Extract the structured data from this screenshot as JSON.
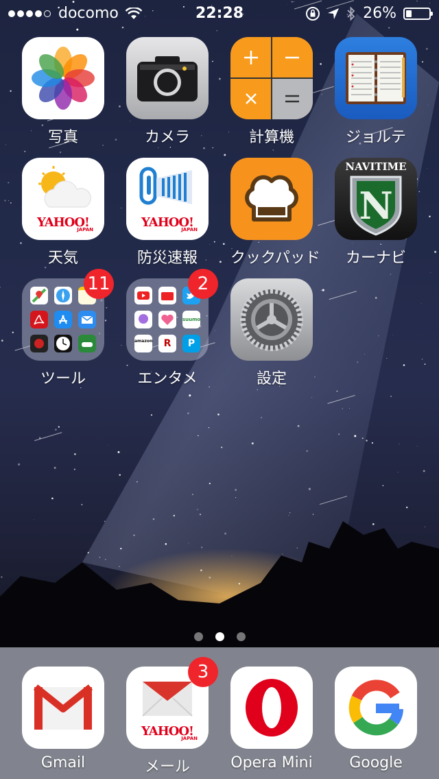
{
  "status_bar": {
    "signal_bars": 5,
    "signal_filled": 4,
    "carrier": "docomo",
    "time": "22:28",
    "battery_percent": "26%",
    "battery_level": 0.26
  },
  "apps": [
    {
      "label": "写真",
      "icon": "photos-icon"
    },
    {
      "label": "カメラ",
      "icon": "camera-icon"
    },
    {
      "label": "計算機",
      "icon": "calculator-icon"
    },
    {
      "label": "ジョルテ",
      "icon": "jorte-planner-icon"
    },
    {
      "label": "天気",
      "icon": "yahoo-weather-icon",
      "brand": "YAHOO!",
      "sub": "JAPAN"
    },
    {
      "label": "防災速報",
      "icon": "yahoo-disaster-alert-icon",
      "brand": "YAHOO!",
      "sub": "JAPAN"
    },
    {
      "label": "クックパッド",
      "icon": "cookpad-icon"
    },
    {
      "label": "カーナビ",
      "icon": "navitime-car-navi-icon",
      "brand": "NAVITIME",
      "letter": "N"
    }
  ],
  "folders": [
    {
      "label": "ツール",
      "badge": "11",
      "icon": "tools-folder-icon"
    },
    {
      "label": "エンタメ",
      "badge": "2",
      "icon": "entertainment-folder-icon",
      "mini_texts": {
        "suumo": "suumo",
        "amazon": "amazon",
        "r": "R",
        "p": "P"
      }
    },
    {
      "label": "設定",
      "icon": "settings-gear-icon"
    }
  ],
  "page_indicator": {
    "count": 3,
    "current": 1
  },
  "dock": [
    {
      "label": "Gmail",
      "icon": "gmail-icon"
    },
    {
      "label": "メール",
      "icon": "yahoo-mail-icon",
      "badge": "3",
      "brand": "YAHOO!",
      "sub": "JAPAN"
    },
    {
      "label": "Opera Mini",
      "icon": "opera-mini-icon"
    },
    {
      "label": "Google",
      "icon": "google-icon"
    }
  ],
  "colors": {
    "badge": "#f0242b",
    "calculator_orange": "#f89b1c",
    "cookpad_orange": "#f7931d",
    "yahoo_red": "#e0001b"
  }
}
